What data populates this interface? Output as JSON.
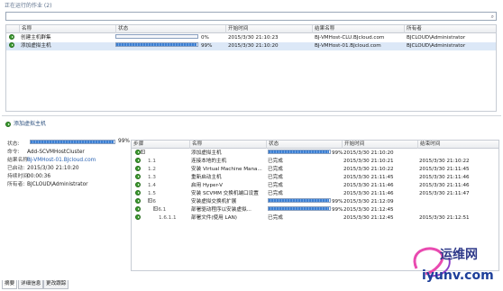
{
  "window": {
    "title": "正在运行的作业 (2)"
  },
  "jobs": {
    "headers": [
      "名称",
      "状态",
      "开始时间",
      "结果名称",
      "所有者"
    ],
    "rows": [
      {
        "name": "创建主机群集",
        "progress": 0,
        "progress_text": "0%",
        "start": "2015/3/30 21:10:23",
        "result": "BJ-VMHost-CLU.BJcloud.com",
        "owner": "BJCLOUD\\Administrator"
      },
      {
        "name": "添加虚拟主机",
        "progress": 99,
        "progress_text": "99%",
        "start": "2015/3/30 21:10:20",
        "result": "BJ-VMHost-01.BJcloud.com",
        "owner": "BJCLOUD\\Administrator"
      }
    ]
  },
  "detail": {
    "title": "添加虚拟主机",
    "status_label": "状态:",
    "status_progress": 99,
    "status_text": "99%",
    "command_label": "命令:",
    "command": "Add-SCVMHostCluster",
    "result_label": "结果名称:",
    "result": "BJ-VMHost-01.BJcloud.com",
    "started_label": "已启动:",
    "started": "2015/3/30 21:10:20",
    "duration_label": "持续时间:",
    "duration": "00:00:36",
    "owner_label": "所有者:",
    "owner": "BJCLOUD\\Administrator"
  },
  "steps": {
    "headers": [
      "步骤",
      "名称",
      "状态",
      "开始时间",
      "结束时间"
    ],
    "rows": [
      {
        "step": "1",
        "name": "添加虚拟主机",
        "status": "",
        "progress": 99,
        "progress_text": "99%",
        "start": "2015/3/30 21:10:20",
        "end": "",
        "expander": "⊟"
      },
      {
        "step": "1.1",
        "name": "连接本地的主机",
        "status": "已完成",
        "start": "2015/3/30 21:10:21",
        "end": "2015/3/30 21:10:22"
      },
      {
        "step": "1.2",
        "name": "安装 Virtual Machine Mana...",
        "status": "已完成",
        "start": "2015/3/30 21:10:22",
        "end": "2015/3/30 21:11:45"
      },
      {
        "step": "1.3",
        "name": "重新启动主机",
        "status": "已完成",
        "start": "2015/3/30 21:11:45",
        "end": "2015/3/30 21:11:46"
      },
      {
        "step": "1.4",
        "name": "启用 Hyper-V",
        "status": "已完成",
        "start": "2015/3/30 21:11:46",
        "end": "2015/3/30 21:11:46"
      },
      {
        "step": "1.5",
        "name": "安装 SCVMM 交换机端口设置",
        "status": "已完成",
        "start": "2015/3/30 21:11:46",
        "end": "2015/3/30 21:11:47"
      },
      {
        "step": "1.6",
        "name": "安装虚拟交换机扩展",
        "status": "",
        "progress": 99,
        "progress_text": "99%",
        "start": "2015/3/30 21:12:09",
        "end": "",
        "expander": "⊟"
      },
      {
        "step": "1.6.1",
        "name": "部署驱动程序以安装虚拟...",
        "status": "",
        "progress": 99,
        "progress_text": "99%",
        "start": "2015/3/30 21:12:45",
        "end": "",
        "expander": "⊟"
      },
      {
        "step": "1.6.1.1",
        "name": "部署文件(使用 LAN)",
        "status": "已完成",
        "start": "2015/3/30 21:12:45",
        "end": "2015/3/30 21:12:51"
      }
    ]
  },
  "tabs": [
    "摘要",
    "详细信息",
    "更改跟踪"
  ],
  "watermark": {
    "line1": "运维网",
    "line2": "iyunv.com"
  },
  "colors": {
    "accent": "#2962b3",
    "progress": "#3d7fd1",
    "success": "#3a9b2e",
    "selection": "#dce8f7"
  },
  "icons": {
    "job_running": "play-circle-icon",
    "search": "search-icon"
  }
}
